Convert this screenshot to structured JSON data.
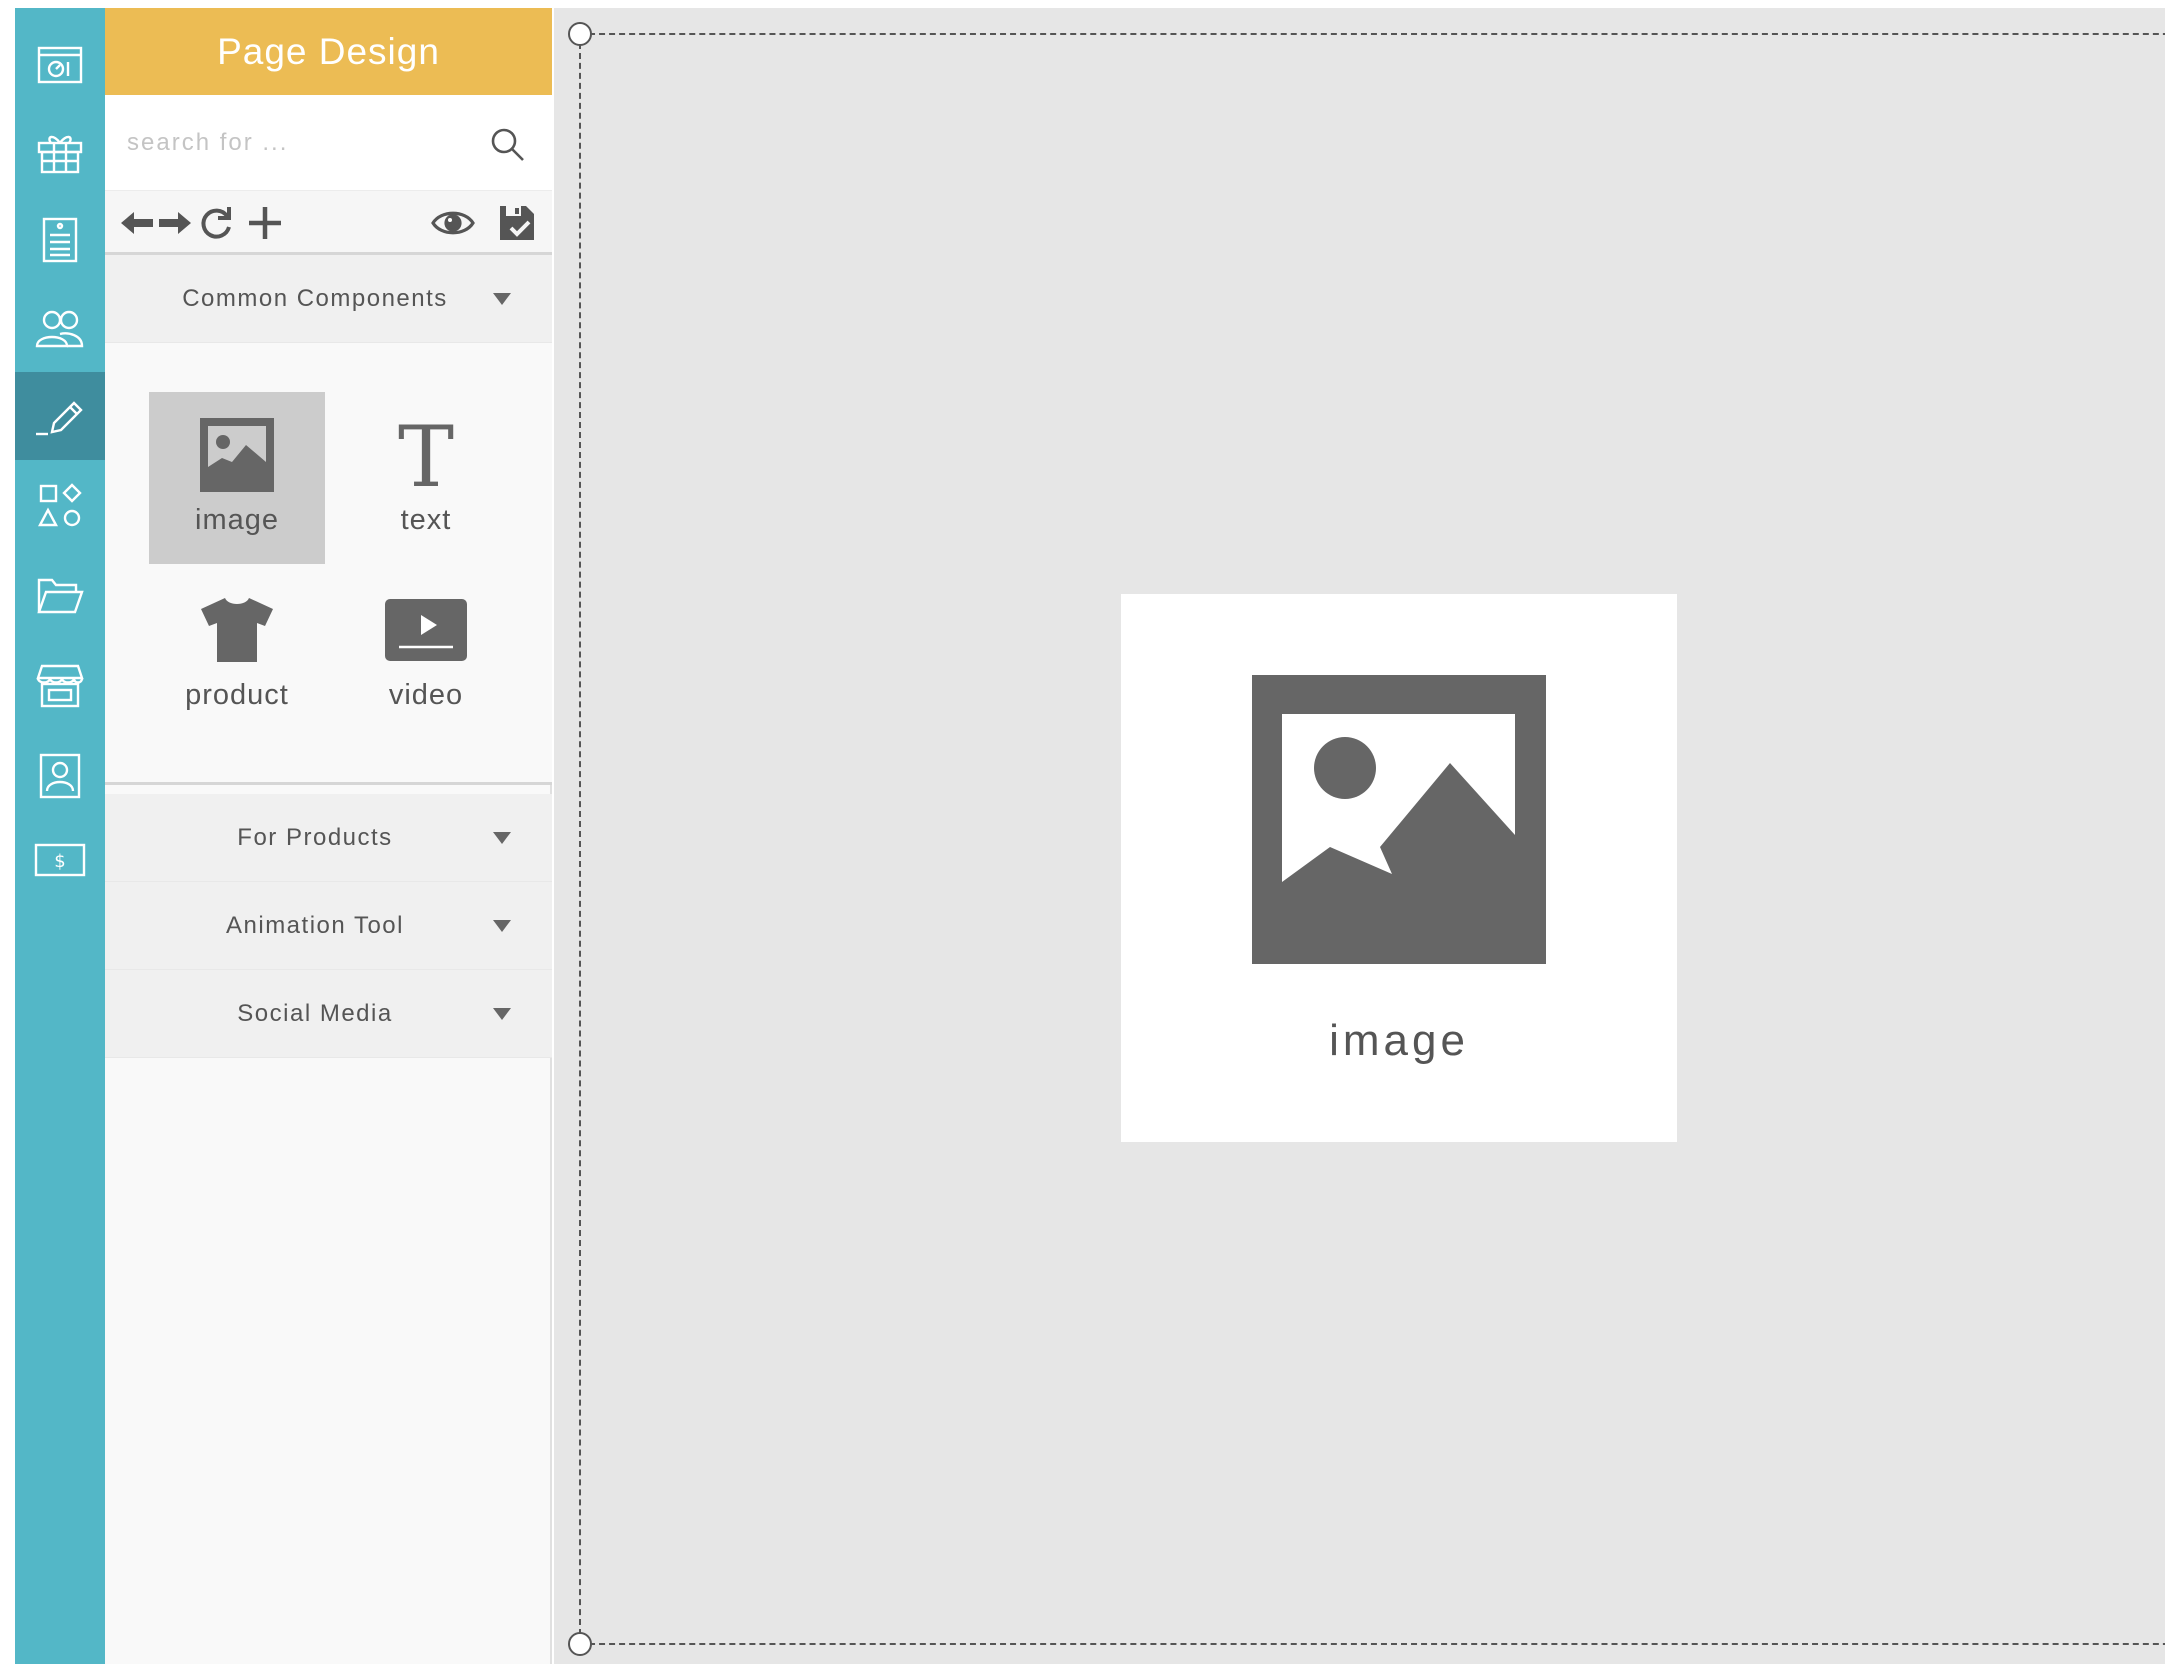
{
  "rail": {
    "items": [
      {
        "name": "dashboard-icon",
        "active": false
      },
      {
        "name": "gift-icon",
        "active": false
      },
      {
        "name": "clipboard-icon",
        "active": false
      },
      {
        "name": "users-icon",
        "active": false
      },
      {
        "name": "page-design-pencil-icon",
        "active": true
      },
      {
        "name": "shapes-icon",
        "active": false
      },
      {
        "name": "folder-icon",
        "active": false
      },
      {
        "name": "store-icon",
        "active": false
      },
      {
        "name": "contact-card-icon",
        "active": false
      },
      {
        "name": "dollar-bill-icon",
        "active": false
      }
    ]
  },
  "panel": {
    "title": "Page Design",
    "search_placeholder": "search for ...",
    "toolbar": [
      "arrow-left-icon",
      "arrow-right-icon",
      "refresh-icon",
      "plus-icon",
      "eye-icon",
      "save-icon"
    ],
    "sections": {
      "common": "Common Components",
      "products": "For Products",
      "animation": "Animation Tool",
      "social": "Social Media"
    },
    "components": {
      "image": "image",
      "text": "text",
      "product": "product",
      "video": "video"
    }
  },
  "canvas": {
    "element_label": "image"
  },
  "colors": {
    "rail": "#53b7c7",
    "rail_active": "#3f8d9e",
    "header": "#ecbc54",
    "canvas": "#e6e6e6",
    "icon_gray": "#666666"
  }
}
